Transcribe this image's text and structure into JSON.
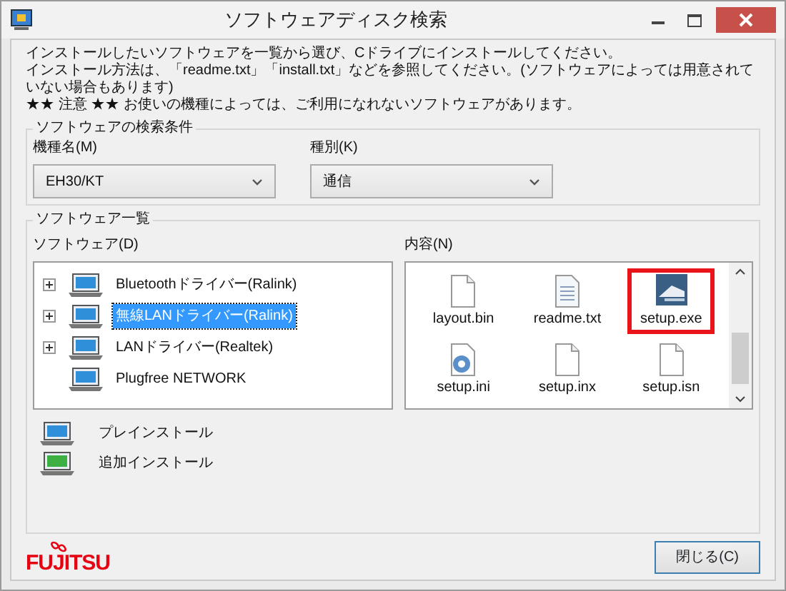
{
  "window": {
    "title": "ソフトウェアディスク検索"
  },
  "instructions": [
    "インストールしたいソフトウェアを一覧から選び、Cドライブにインストールしてください。",
    "インストール方法は、「readme.txt」「install.txt」などを参照してください。(ソフトウェアによっては用意されていない場合もあります)",
    "★★ 注意 ★★ お使いの機種によっては、ご利用になれないソフトウェアがあります。"
  ],
  "search_conditions": {
    "title": "ソフトウェアの検索条件",
    "fields": [
      {
        "label": "機種名(M)",
        "value": "EH30/KT"
      },
      {
        "label": "種別(K)",
        "value": "通信"
      }
    ]
  },
  "software_list": {
    "title": "ソフトウェア一覧",
    "tree_label": "ソフトウェア(D)",
    "contents_label": "内容(N)",
    "tree": [
      {
        "label": "Bluetoothドライバー(Ralink)",
        "kind": "collapsed",
        "selected": false
      },
      {
        "label": "無線LANドライバー(Ralink)",
        "kind": "collapsed",
        "selected": true
      },
      {
        "label": "LANドライバー(Realtek)",
        "kind": "collapsed",
        "selected": false
      },
      {
        "label": "Plugfree NETWORK",
        "kind": "leaf",
        "selected": false
      }
    ],
    "files": [
      {
        "name": "layout.bin",
        "kind": "blank",
        "highlighted": false
      },
      {
        "name": "readme.txt",
        "kind": "text",
        "highlighted": false
      },
      {
        "name": "setup.exe",
        "kind": "app",
        "highlighted": true
      },
      {
        "name": "setup.ini",
        "kind": "settings",
        "highlighted": false
      },
      {
        "name": "setup.inx",
        "kind": "blank",
        "highlighted": false
      },
      {
        "name": "setup.isn",
        "kind": "blank",
        "highlighted": false
      }
    ],
    "legend": [
      {
        "label": "プレインストール",
        "color": "#2f8fd8"
      },
      {
        "label": "追加インストール",
        "color": "#3cb043"
      }
    ]
  },
  "footer": {
    "logo": "FUJITSU",
    "buttons": [
      {
        "label": "閉じる(C)"
      }
    ]
  }
}
